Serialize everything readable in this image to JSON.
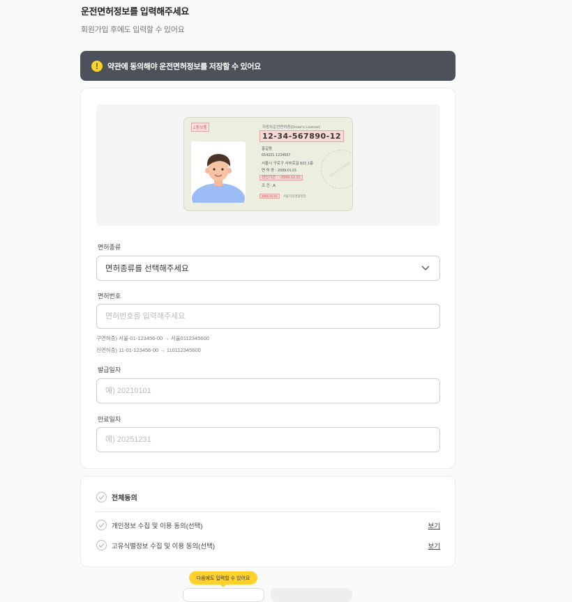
{
  "header": {
    "title": "운전면허정보를 입력해주세요",
    "subtitle": "회원가입 후에도 입력할 수 있어요"
  },
  "notice": {
    "icon": "exclamation-icon",
    "text": "약관에 동의해야 운전면허정보를 저장할 수 있어요"
  },
  "license_sample": {
    "type_badge": "1종보통",
    "header": "자동차운전면허증(Driver's License)",
    "number": "12-34-567890-12",
    "name": "홍길동",
    "resident_number": "654321-1234567",
    "address": "서울시 구로구 서부로길 822 1층",
    "issue_line": "면 허 증 : 2099.01.01",
    "renewal_line": "갱신기간 : ~2099.12.31",
    "condition_line": "조       건 : A",
    "footer_date": "2099.01.01",
    "footer_issuer": "서울지방경찰청장",
    "seal_text": "Driver's License"
  },
  "form": {
    "license_type": {
      "label": "면허종류",
      "selected": "면허종류를 선택해주세요"
    },
    "license_number": {
      "label": "면허번호",
      "placeholder": "면허번호를 입력해주세요",
      "hint_old": "구면허증) 서울-01-123456-00 → 서울0112345600",
      "hint_new": "신면허증) 11-01-123456-00 → 110112345600"
    },
    "issue_date": {
      "label": "발급일자",
      "placeholder": "예) 20210101"
    },
    "expiry_date": {
      "label": "만료일자",
      "placeholder": "예) 20251231"
    }
  },
  "agreement": {
    "all_label": "전체동의",
    "items": [
      {
        "label": "개인정보 수집 및 이용 동의(선택)",
        "link": "보기"
      },
      {
        "label": "고유식별정보 수집 및 이용 동의(선택)",
        "link": "보기"
      }
    ]
  },
  "footer": {
    "tooltip": "다음에도 입력할 수 있어요"
  },
  "colors": {
    "notice_bg": "#4d5159",
    "accent_yellow": "#ffd12a",
    "highlight_red": "#c25a5a"
  }
}
